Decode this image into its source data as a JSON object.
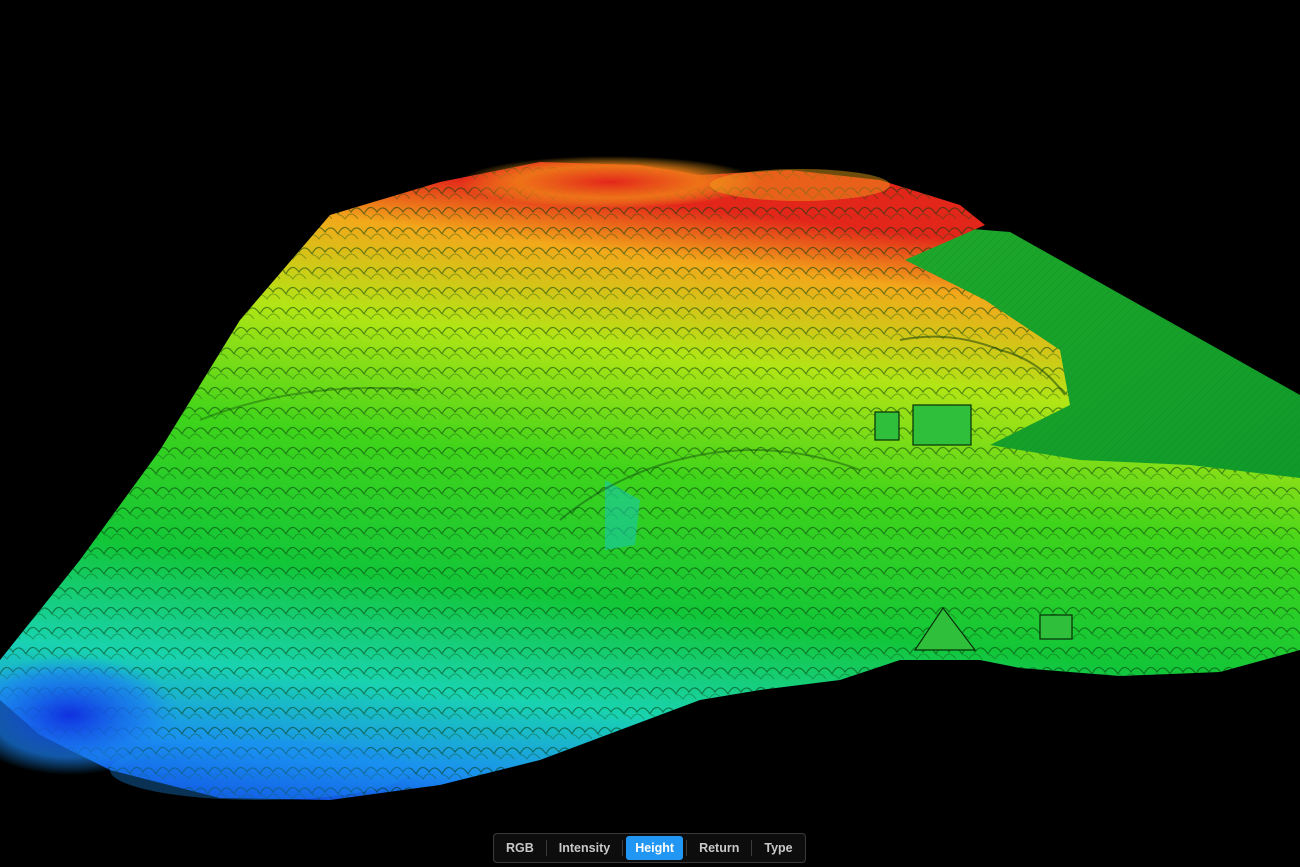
{
  "viewer": {
    "background": "#000000",
    "color_ramp": [
      "#0b1fd6",
      "#1a8ff0",
      "#19d3b0",
      "#12c638",
      "#3fd41a",
      "#b2e515",
      "#f2a81a",
      "#e2261a"
    ]
  },
  "toolbar": {
    "buttons": [
      {
        "label": "RGB",
        "active": false
      },
      {
        "label": "Intensity",
        "active": false
      },
      {
        "label": "Height",
        "active": true
      },
      {
        "label": "Return",
        "active": false
      },
      {
        "label": "Type",
        "active": false
      }
    ],
    "active_color": "#2196f3"
  }
}
